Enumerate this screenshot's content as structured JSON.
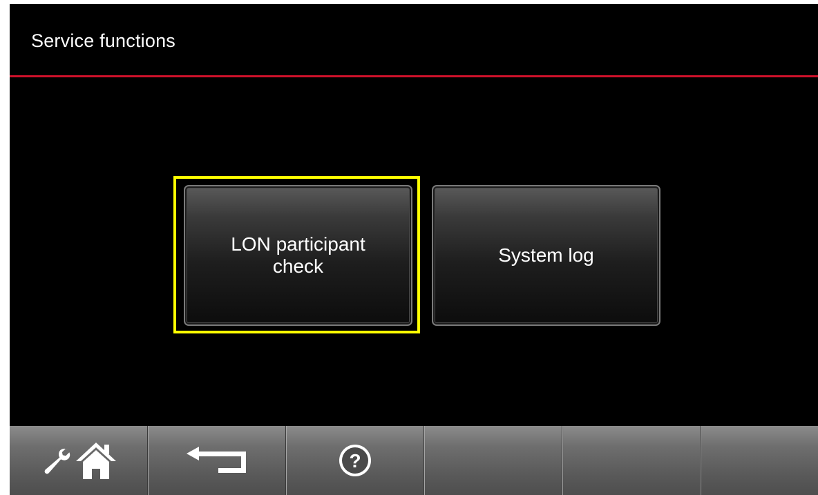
{
  "header": {
    "title": "Service functions",
    "accent_color": "#d0112b"
  },
  "buttons": [
    {
      "label": "LON participant\ncheck",
      "highlighted": true
    },
    {
      "label": "System log",
      "highlighted": false
    }
  ],
  "highlight_color": "#ffff00",
  "toolbar": {
    "items": [
      {
        "icons": [
          "wrench-icon",
          "home-icon"
        ]
      },
      {
        "icons": [
          "back-arrow-icon"
        ]
      },
      {
        "icons": [
          "help-icon"
        ]
      },
      {
        "icons": []
      },
      {
        "icons": []
      },
      {
        "icons": []
      }
    ]
  }
}
